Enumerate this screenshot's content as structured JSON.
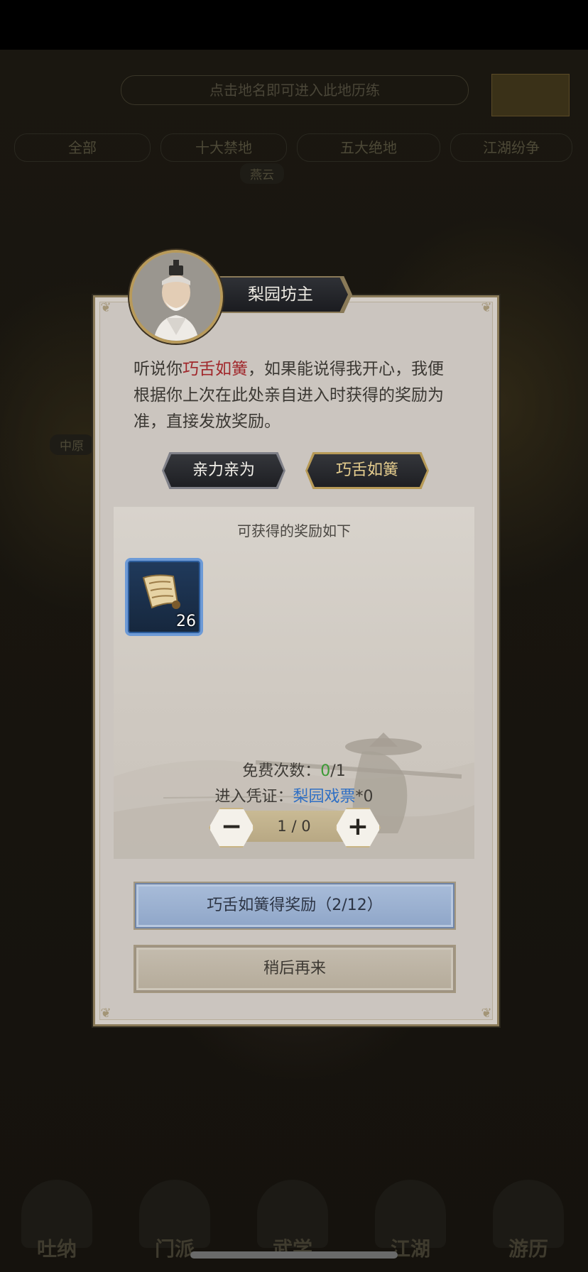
{
  "background": {
    "hint": "点击地名即可进入此地历练",
    "tabs": [
      "全部",
      "十大禁地",
      "五大绝地",
      "江湖纷争"
    ],
    "labels": [
      "燕云",
      "中原"
    ],
    "nav": [
      "吐纳",
      "门派",
      "武学",
      "江湖",
      "游历"
    ]
  },
  "dialog": {
    "npc_name": "梨园坊主",
    "desc_prefix": "听说你",
    "desc_highlight": "巧舌如簧",
    "desc_suffix": "，如果能说得我开心，我便根据你上次在此处亲自进入时获得的奖励为准，直接发放奖励。",
    "mode_buttons": [
      "亲力亲为",
      "巧舌如簧"
    ],
    "selected_mode": "巧舌如簧",
    "reward_title": "可获得的奖励如下",
    "reward_item": {
      "icon": "scroll-icon",
      "count": "26"
    },
    "free_label": "免费次数：",
    "free_used": "0",
    "free_total": "/1",
    "ticket_label": "进入凭证：",
    "ticket_name": "梨园戏票",
    "ticket_count": "*0",
    "stepper_value": "1 / 0",
    "primary_button": "巧舌如簧得奖励（2/12）",
    "secondary_button": "稍后再来"
  },
  "colors": {
    "highlight_red": "#a0272b",
    "free_green": "#3c9a35",
    "ticket_blue": "#2f6fc4",
    "primary_button": "#9fb4d3"
  }
}
